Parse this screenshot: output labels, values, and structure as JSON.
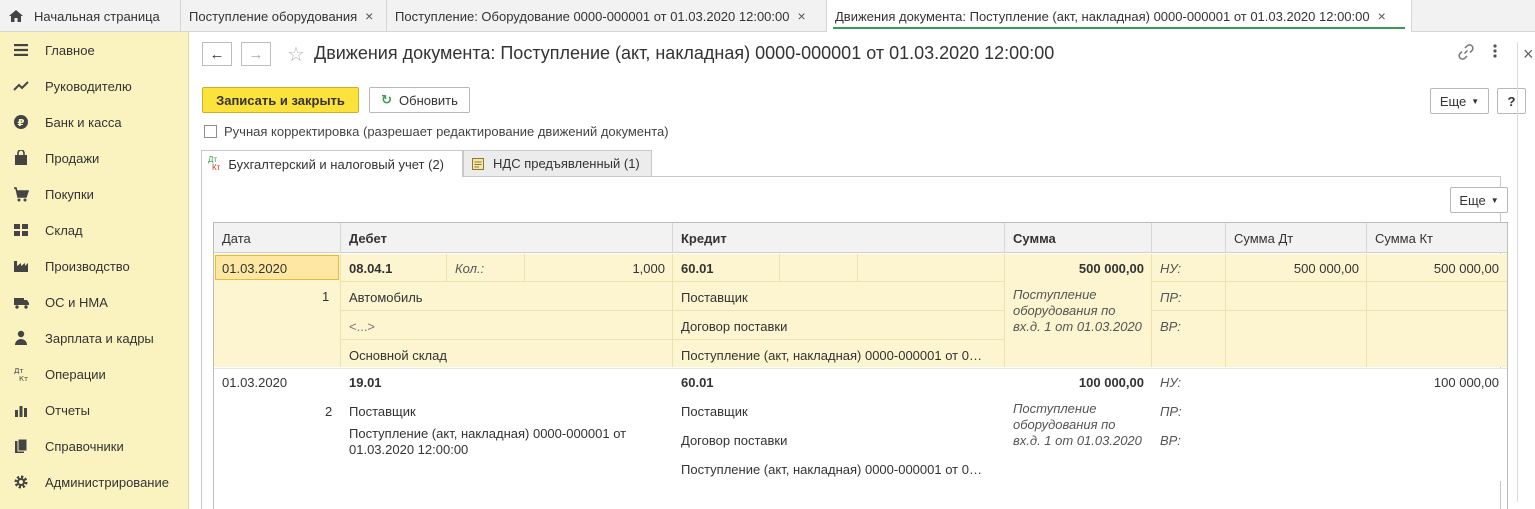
{
  "tabs": [
    {
      "label": "Начальная страница"
    },
    {
      "label": "Поступление оборудования",
      "close": "×"
    },
    {
      "label": "Поступление: Оборудование 0000-000001 от 01.03.2020 12:00:00",
      "close": "×"
    },
    {
      "label": "Движения документа: Поступление (акт, накладная) 0000-000001 от 01.03.2020 12:00:00",
      "close": "×"
    }
  ],
  "sidebar": {
    "items": [
      {
        "label": "Главное",
        "icon": "menu-icon"
      },
      {
        "label": "Руководителю",
        "icon": "trend-icon"
      },
      {
        "label": "Банк и касса",
        "icon": "ruble-icon"
      },
      {
        "label": "Продажи",
        "icon": "bag-icon"
      },
      {
        "label": "Покупки",
        "icon": "cart-icon"
      },
      {
        "label": "Склад",
        "icon": "grid-icon"
      },
      {
        "label": "Производство",
        "icon": "factory-icon"
      },
      {
        "label": "ОС и НМА",
        "icon": "truck-icon"
      },
      {
        "label": "Зарплата и кадры",
        "icon": "people-icon"
      },
      {
        "label": "Операции",
        "icon": "dt-kt-icon"
      },
      {
        "label": "Отчеты",
        "icon": "bar-chart-icon"
      },
      {
        "label": "Справочники",
        "icon": "book-icon"
      },
      {
        "label": "Администрирование",
        "icon": "gear-icon"
      }
    ]
  },
  "header": {
    "title": "Движения документа: Поступление (акт, накладная) 0000-000001 от 01.03.2020 12:00:00",
    "back": "←",
    "forward": "→"
  },
  "toolbar": {
    "save_close": "Записать и закрыть",
    "refresh": "Обновить",
    "more": "Еще",
    "help": "?"
  },
  "manual_edit_label": "Ручная корректировка (разрешает редактирование движений документа)",
  "form_tabs": [
    {
      "label": "Бухгалтерский и налоговый учет (2)",
      "icon_top": "Дт",
      "icon_bottom": "Кт"
    },
    {
      "label": "НДС предъявленный (1)"
    }
  ],
  "grid_more": "Еще",
  "columns": {
    "date": "Дата",
    "debit": "Дебет",
    "credit": "Кредит",
    "sum": "Сумма",
    "sum_dt": "Сумма Дт",
    "sum_kt": "Сумма Кт"
  },
  "rows": [
    {
      "date": "01.03.2020",
      "num": "1",
      "debit_account": "08.04.1",
      "qty_label": "Кол.:",
      "qty": "1,000",
      "debit_sub1": "Автомобиль",
      "debit_sub2": "<...>",
      "debit_sub3": "Основной склад",
      "credit_account": "60.01",
      "credit_sub1": "Поставщик",
      "credit_sub2": "Договор поставки",
      "credit_sub3": "Поступление (акт, накладная) 0000-000001 от 0…",
      "sum": "500 000,00",
      "content": "Поступление оборудования по вх.д. 1 от 01.03.2020",
      "nu": "НУ:",
      "pr": "ПР:",
      "vr": "ВР:",
      "sum_dt": "500 000,00",
      "sum_kt": "500 000,00"
    },
    {
      "date": "01.03.2020",
      "num": "2",
      "debit_account": "19.01",
      "debit_sub1": "Поставщик",
      "debit_sub2": "Поступление (акт, накладная) 0000-000001 от 01.03.2020 12:00:00",
      "credit_account": "60.01",
      "credit_sub1": "Поставщик",
      "credit_sub2": "Договор поставки",
      "credit_sub3": "Поступление (акт, накладная) 0000-000001 от 0…",
      "sum": "100 000,00",
      "content": "Поступление оборудования по вх.д. 1 от 01.03.2020",
      "nu": "НУ:",
      "pr": "ПР:",
      "vr": "ВР:",
      "sum_kt": "100 000,00"
    }
  ],
  "colors": {
    "sidebar_bg": "#fbf3bf",
    "primary_button": "#fde23b",
    "row_selected": "#fcf5cf",
    "active_tab_underline": "#3a9a54"
  }
}
